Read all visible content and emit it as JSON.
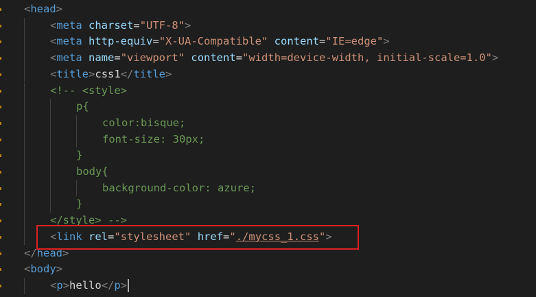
{
  "lines": [
    {
      "parts": [
        {
          "t": "<",
          "c": "bracket"
        },
        {
          "t": "head",
          "c": "tag"
        },
        {
          "t": ">",
          "c": "bracket"
        }
      ]
    },
    {
      "parts": [
        {
          "t": "<",
          "c": "bracket"
        },
        {
          "t": "meta",
          "c": "tag"
        },
        {
          "t": " ",
          "c": "txt"
        },
        {
          "t": "charset",
          "c": "attr"
        },
        {
          "t": "=",
          "c": "txt"
        },
        {
          "t": "\"UTF-8\"",
          "c": "str"
        },
        {
          "t": ">",
          "c": "bracket"
        }
      ]
    },
    {
      "parts": [
        {
          "t": "<",
          "c": "bracket"
        },
        {
          "t": "meta",
          "c": "tag"
        },
        {
          "t": " ",
          "c": "txt"
        },
        {
          "t": "http-equiv",
          "c": "attr"
        },
        {
          "t": "=",
          "c": "txt"
        },
        {
          "t": "\"X-UA-Compatible\"",
          "c": "str"
        },
        {
          "t": " ",
          "c": "txt"
        },
        {
          "t": "content",
          "c": "attr"
        },
        {
          "t": "=",
          "c": "txt"
        },
        {
          "t": "\"IE=edge\"",
          "c": "str"
        },
        {
          "t": ">",
          "c": "bracket"
        }
      ]
    },
    {
      "parts": [
        {
          "t": "<",
          "c": "bracket"
        },
        {
          "t": "meta",
          "c": "tag"
        },
        {
          "t": " ",
          "c": "txt"
        },
        {
          "t": "name",
          "c": "attr"
        },
        {
          "t": "=",
          "c": "txt"
        },
        {
          "t": "\"viewport\"",
          "c": "str"
        },
        {
          "t": " ",
          "c": "txt"
        },
        {
          "t": "content",
          "c": "attr"
        },
        {
          "t": "=",
          "c": "txt"
        },
        {
          "t": "\"width=device-width, initial-scale=1.0\"",
          "c": "str"
        },
        {
          "t": ">",
          "c": "bracket"
        }
      ]
    },
    {
      "parts": [
        {
          "t": "<",
          "c": "bracket"
        },
        {
          "t": "title",
          "c": "tag"
        },
        {
          "t": ">",
          "c": "bracket"
        },
        {
          "t": "css1",
          "c": "txt"
        },
        {
          "t": "</",
          "c": "bracket"
        },
        {
          "t": "title",
          "c": "tag"
        },
        {
          "t": ">",
          "c": "bracket"
        }
      ]
    },
    {
      "parts": [
        {
          "t": "<!-- <style>",
          "c": "cm"
        }
      ]
    },
    {
      "parts": [
        {
          "t": "p{",
          "c": "cm"
        }
      ]
    },
    {
      "parts": [
        {
          "t": "color:bisque;",
          "c": "cm"
        }
      ]
    },
    {
      "parts": [
        {
          "t": "font-size: 30px;",
          "c": "cm"
        }
      ]
    },
    {
      "parts": [
        {
          "t": "}",
          "c": "cm"
        }
      ]
    },
    {
      "parts": [
        {
          "t": "body{",
          "c": "cm"
        }
      ]
    },
    {
      "parts": [
        {
          "t": "background-color: azure;",
          "c": "cm"
        }
      ]
    },
    {
      "parts": [
        {
          "t": "}",
          "c": "cm"
        }
      ]
    },
    {
      "parts": [
        {
          "t": "</style> -->",
          "c": "cm"
        }
      ]
    },
    {
      "parts": [
        {
          "t": "<",
          "c": "bracket"
        },
        {
          "t": "link",
          "c": "tag"
        },
        {
          "t": " ",
          "c": "txt"
        },
        {
          "t": "rel",
          "c": "attr"
        },
        {
          "t": "=",
          "c": "txt"
        },
        {
          "t": "\"stylesheet\"",
          "c": "str"
        },
        {
          "t": " ",
          "c": "txt"
        },
        {
          "t": "href",
          "c": "attr"
        },
        {
          "t": "=",
          "c": "txt"
        },
        {
          "t": "\"",
          "c": "str"
        },
        {
          "t": "./mycss_1.css",
          "c": "str link-u"
        },
        {
          "t": "\"",
          "c": "str"
        },
        {
          "t": ">",
          "c": "bracket"
        }
      ]
    },
    {
      "parts": [
        {
          "t": "</",
          "c": "bracket"
        },
        {
          "t": "head",
          "c": "tag"
        },
        {
          "t": ">",
          "c": "bracket"
        }
      ]
    },
    {
      "parts": [
        {
          "t": "<",
          "c": "bracket"
        },
        {
          "t": "body",
          "c": "tag"
        },
        {
          "t": ">",
          "c": "bracket"
        }
      ]
    },
    {
      "parts": [
        {
          "t": "<",
          "c": "bracket"
        },
        {
          "t": "p",
          "c": "tag"
        },
        {
          "t": ">",
          "c": "bracket"
        },
        {
          "t": "hello",
          "c": "txt"
        },
        {
          "t": "</",
          "c": "bracket"
        },
        {
          "t": "p",
          "c": "tag"
        },
        {
          "t": ">",
          "c": "bracket"
        }
      ]
    }
  ],
  "colors": {
    "background": "#1e1e1e",
    "highlight": "#e02020"
  }
}
